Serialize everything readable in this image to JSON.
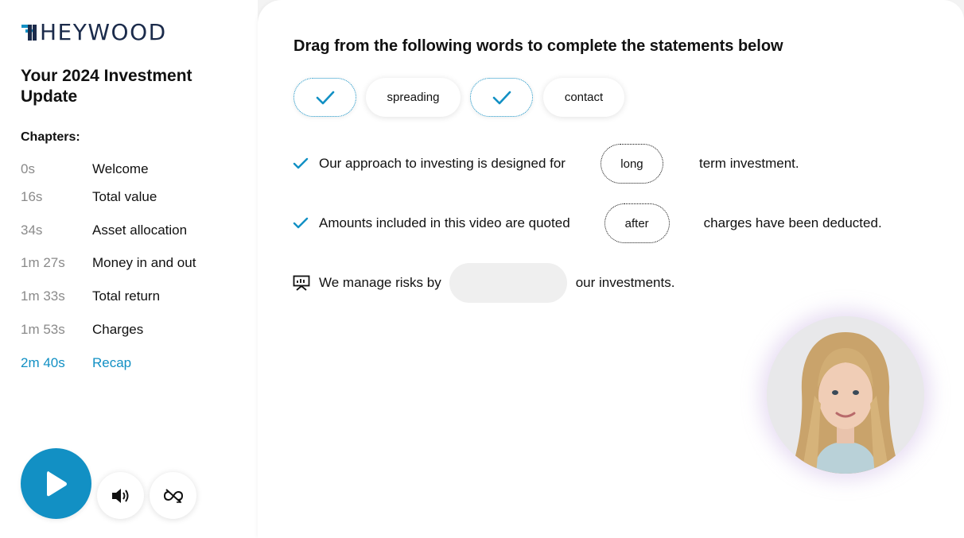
{
  "brand": {
    "logo_text": "HEYWOOD",
    "accent": "#1290c4",
    "navy": "#1b2b4b"
  },
  "course": {
    "title": "Your 2024 Investment Update"
  },
  "chapters": {
    "heading": "Chapters:",
    "items": [
      {
        "time": "0s",
        "label": "Welcome"
      },
      {
        "time": "16s",
        "label": "Total value"
      },
      {
        "time": "34s",
        "label": "Asset allocation"
      },
      {
        "time": "1m 27s",
        "label": "Money in and out"
      },
      {
        "time": "1m 33s",
        "label": "Total return"
      },
      {
        "time": "1m 53s",
        "label": "Charges"
      },
      {
        "time": "2m 40s",
        "label": "Recap",
        "active": true
      }
    ]
  },
  "controls": {
    "play_icon": "play-icon",
    "sound_icon": "speaker-icon",
    "loop_icon": "loop-off-icon"
  },
  "activity": {
    "instructions": "Drag from the following words to complete the statements below",
    "word_bank": [
      {
        "state": "used",
        "icon": "check-icon"
      },
      {
        "state": "available",
        "text": "spreading"
      },
      {
        "state": "used",
        "icon": "check-icon"
      },
      {
        "state": "available",
        "text": "contact"
      }
    ],
    "statements": [
      {
        "status_icon": "check-icon",
        "before": "Our approach to investing is designed for",
        "answer": "long",
        "after": "term investment."
      },
      {
        "status_icon": "check-icon",
        "before": "Amounts included in this video are quoted",
        "answer": "after",
        "after": "charges have been deducted."
      },
      {
        "status_icon": "presentation-icon",
        "before": "We manage risks by",
        "answer": "",
        "after": "our investments."
      }
    ]
  }
}
